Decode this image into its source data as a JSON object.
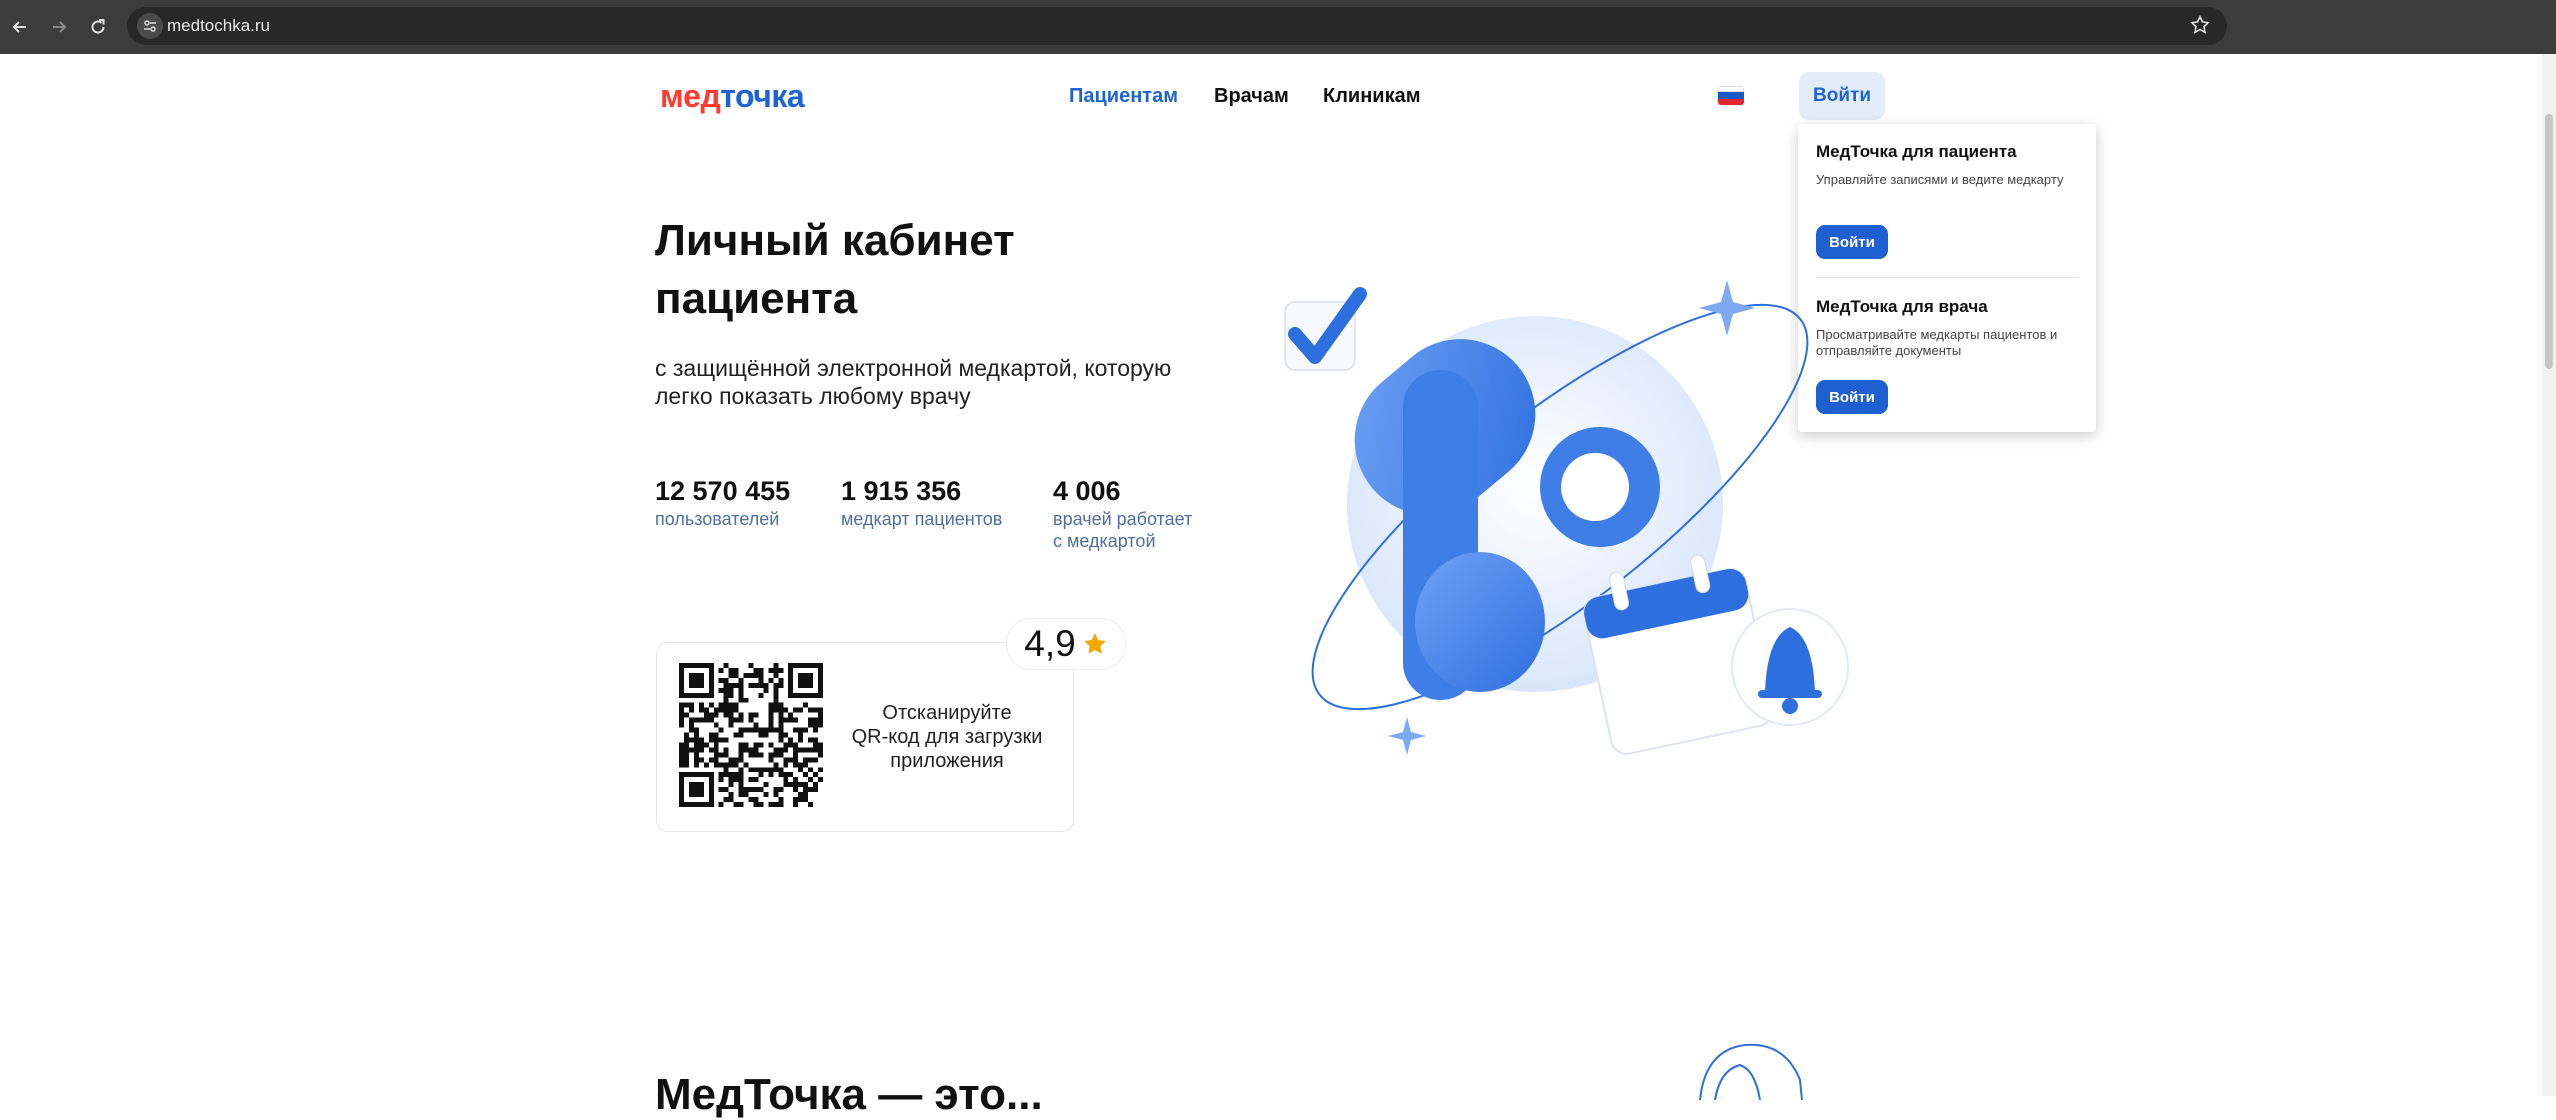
{
  "browser": {
    "url": "medtochka.ru"
  },
  "header": {
    "logo_part1": "мед",
    "logo_part2": "точка",
    "nav": [
      {
        "label": "Пациентам",
        "active": true
      },
      {
        "label": "Врачам",
        "active": false
      },
      {
        "label": "Клиникам",
        "active": false
      }
    ],
    "login_label": "Войти"
  },
  "dropdown": {
    "patient": {
      "title": "МедТочка для пациента",
      "description": "Управляйте записями и ведите медкарту",
      "button": "Войти"
    },
    "doctor": {
      "title": "МедТочка для врача",
      "description": "Просматривайте медкарты пациентов и отправляйте документы",
      "button": "Войти"
    }
  },
  "hero": {
    "title_line1": "Личный кабинет",
    "title_line2": "пациента",
    "subtitle_line1": "с защищённой электронной медкартой, которую",
    "subtitle_line2": "легко показать любому врачу",
    "stats": [
      {
        "value": "12 570 455",
        "label1": "пользователей",
        "label2": ""
      },
      {
        "value": "1 915 356",
        "label1": "медкарт пациентов",
        "label2": ""
      },
      {
        "value": "4 006",
        "label1": "врачей работает",
        "label2": "с медкартой"
      }
    ],
    "qr": {
      "line1": "Отсканируйте",
      "line2": "QR-код для загрузки",
      "line3": "приложения"
    },
    "rating": "4,9"
  },
  "next_section": {
    "title_partial": "МедТочка — это..."
  },
  "colors": {
    "brand_blue": "#1e63d6",
    "brand_red": "#ff3b30",
    "star": "#f7a600"
  }
}
